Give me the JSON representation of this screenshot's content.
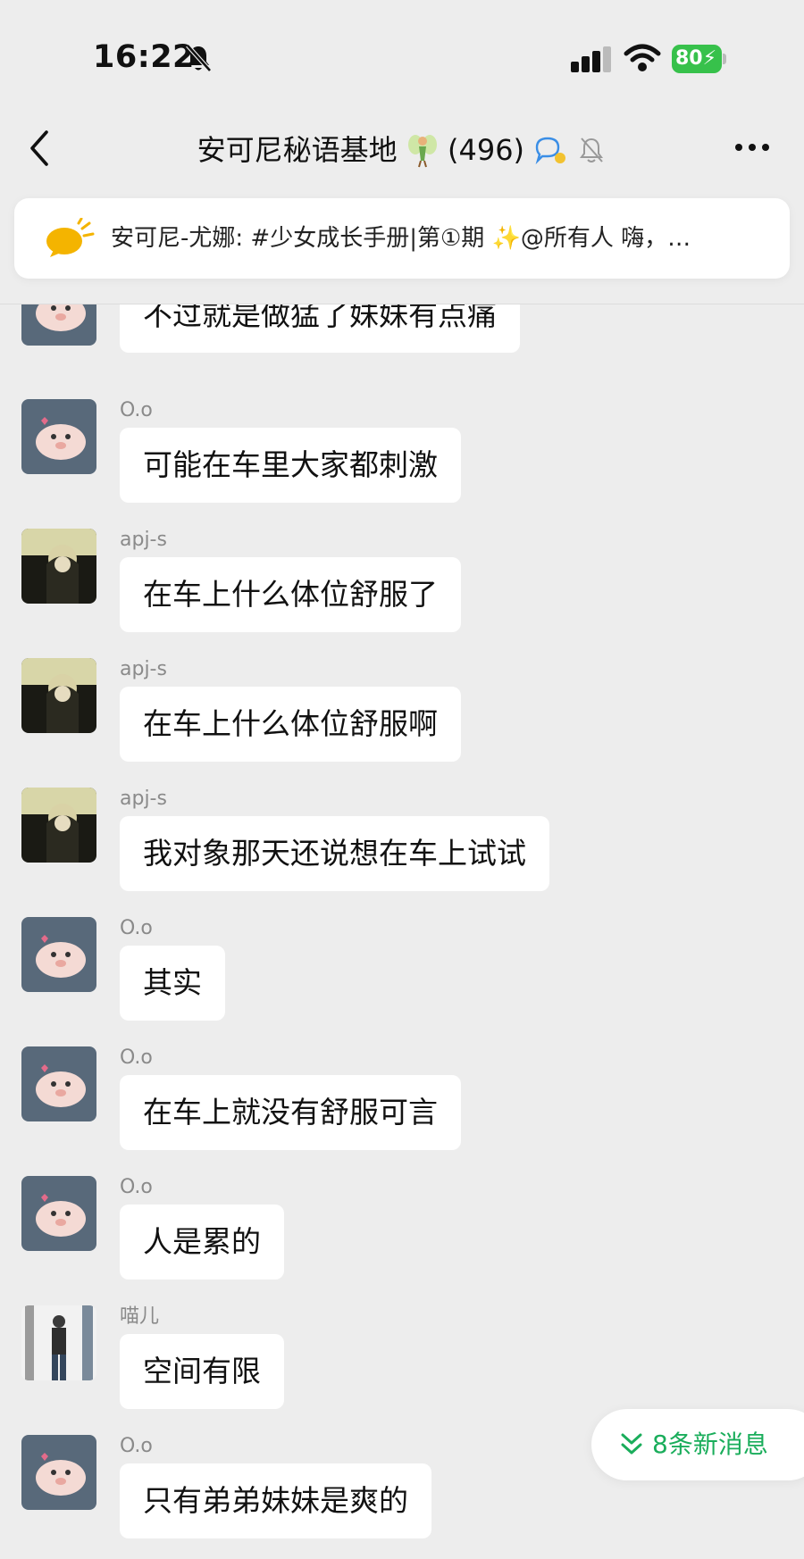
{
  "status_bar": {
    "time": "16:22",
    "battery": "80"
  },
  "header": {
    "group_name": "安可尼秘语基地",
    "member_count": "(496)"
  },
  "notice": {
    "text": "安可尼-尤娜: #少女成长手册|第①期 ✨@所有人  嗨，…"
  },
  "messages": [
    {
      "sender": "",
      "text": "不过就是做猛了妹妹有点痛",
      "avatar": "pig"
    },
    {
      "sender": "O.o",
      "text": "可能在车里大家都刺激",
      "avatar": "pig"
    },
    {
      "sender": "apj-s",
      "text": "在车上什么体位舒服了",
      "avatar": "girl"
    },
    {
      "sender": "apj-s",
      "text": "在车上什么体位舒服啊",
      "avatar": "girl"
    },
    {
      "sender": "apj-s",
      "text": "我对象那天还说想在车上试试",
      "avatar": "girl"
    },
    {
      "sender": "O.o",
      "text": "其实",
      "avatar": "pig"
    },
    {
      "sender": "O.o",
      "text": "在车上就没有舒服可言",
      "avatar": "pig"
    },
    {
      "sender": "O.o",
      "text": "人是累的",
      "avatar": "pig"
    },
    {
      "sender": "喵儿",
      "text": "空间有限",
      "avatar": "photo"
    },
    {
      "sender": "O.o",
      "text": "只有弟弟妹妹是爽的",
      "avatar": "pig"
    }
  ],
  "new_messages": {
    "label": "8条新消息"
  },
  "icons": {
    "back": "chevron-left-icon",
    "more": "more-icon",
    "muted": "bell-off-icon",
    "notice": "announcement-icon",
    "new": "double-chevron-down-icon"
  },
  "colors": {
    "background": "#ededed",
    "bubble": "#ffffff",
    "accent": "#1aad5b",
    "battery": "#37c14b"
  }
}
